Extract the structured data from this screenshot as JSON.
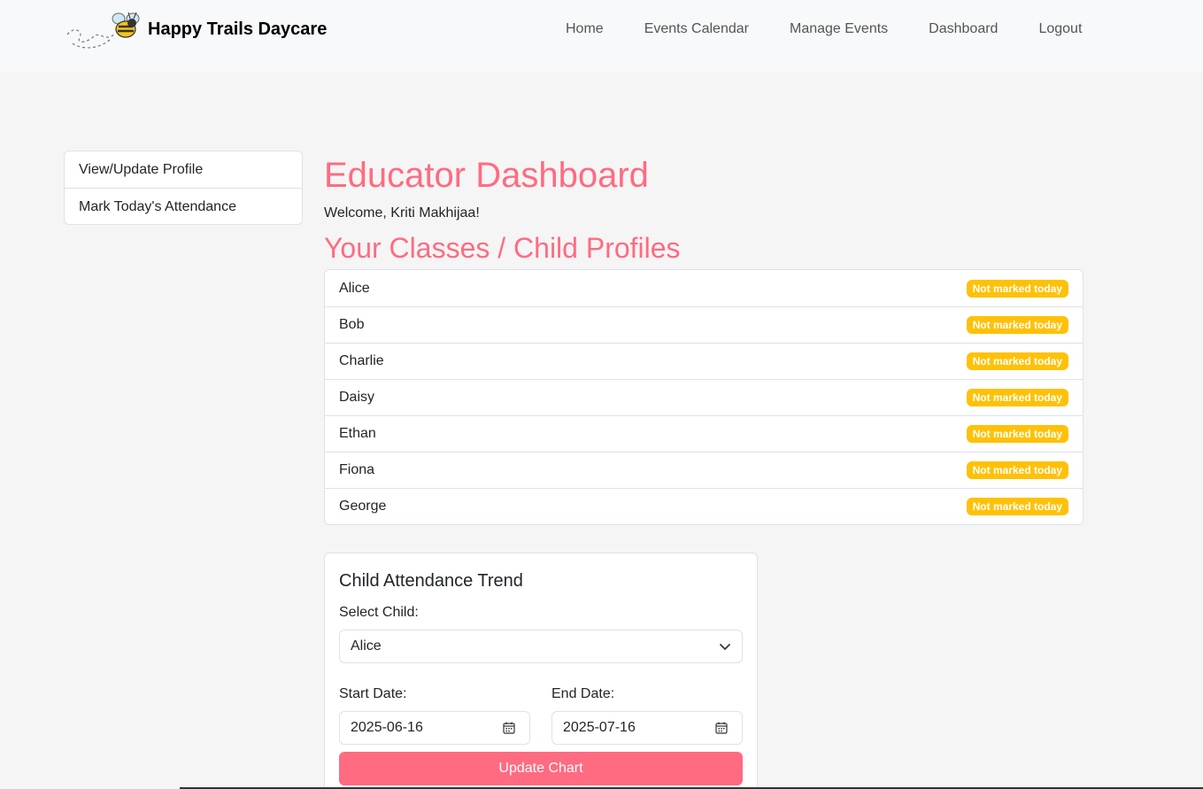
{
  "brand": {
    "name": "Happy Trails Daycare",
    "logo_icon": "bee-icon"
  },
  "nav": {
    "items": [
      {
        "label": "Home"
      },
      {
        "label": "Events Calendar"
      },
      {
        "label": "Manage Events"
      },
      {
        "label": "Dashboard"
      },
      {
        "label": "Logout"
      }
    ]
  },
  "sidebar": {
    "items": [
      {
        "label": "View/Update Profile"
      },
      {
        "label": "Mark Today's Attendance"
      }
    ]
  },
  "main": {
    "title": "Educator Dashboard",
    "welcome": "Welcome, Kriti Makhijaa!",
    "section_title": "Your Classes / Child Profiles",
    "children": [
      {
        "name": "Alice",
        "status": "Not marked today"
      },
      {
        "name": "Bob",
        "status": "Not marked today"
      },
      {
        "name": "Charlie",
        "status": "Not marked today"
      },
      {
        "name": "Daisy",
        "status": "Not marked today"
      },
      {
        "name": "Ethan",
        "status": "Not marked today"
      },
      {
        "name": "Fiona",
        "status": "Not marked today"
      },
      {
        "name": "George",
        "status": "Not marked today"
      }
    ]
  },
  "trend": {
    "title": "Child Attendance Trend",
    "select_label": "Select Child:",
    "selected_child": "Alice",
    "start_label": "Start Date:",
    "start_value": "2025-06-16",
    "end_label": "End Date:",
    "end_value": "2025-07-16",
    "button_label": "Update Chart"
  },
  "colors": {
    "accent": "#ff6b81",
    "badge": "#ffc107",
    "navbar_bg": "#f8f9fa",
    "page_bg": "#f5f5f5"
  }
}
